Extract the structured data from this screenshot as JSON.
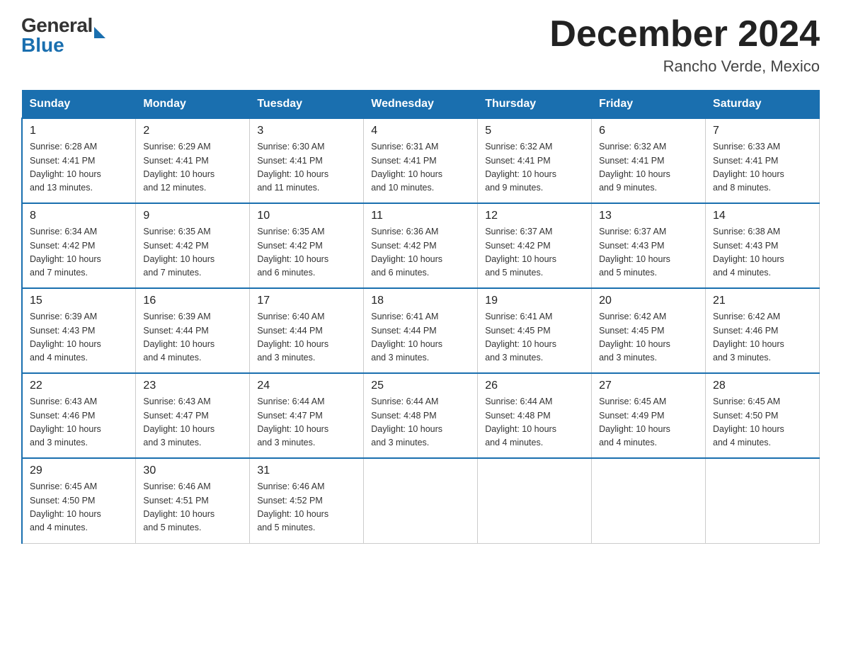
{
  "header": {
    "logo_general": "General",
    "logo_blue": "Blue",
    "title": "December 2024",
    "subtitle": "Rancho Verde, Mexico"
  },
  "days_of_week": [
    "Sunday",
    "Monday",
    "Tuesday",
    "Wednesday",
    "Thursday",
    "Friday",
    "Saturday"
  ],
  "weeks": [
    [
      {
        "day": "1",
        "sunrise": "6:28 AM",
        "sunset": "4:41 PM",
        "daylight": "10 hours and 13 minutes."
      },
      {
        "day": "2",
        "sunrise": "6:29 AM",
        "sunset": "4:41 PM",
        "daylight": "10 hours and 12 minutes."
      },
      {
        "day": "3",
        "sunrise": "6:30 AM",
        "sunset": "4:41 PM",
        "daylight": "10 hours and 11 minutes."
      },
      {
        "day": "4",
        "sunrise": "6:31 AM",
        "sunset": "4:41 PM",
        "daylight": "10 hours and 10 minutes."
      },
      {
        "day": "5",
        "sunrise": "6:32 AM",
        "sunset": "4:41 PM",
        "daylight": "10 hours and 9 minutes."
      },
      {
        "day": "6",
        "sunrise": "6:32 AM",
        "sunset": "4:41 PM",
        "daylight": "10 hours and 9 minutes."
      },
      {
        "day": "7",
        "sunrise": "6:33 AM",
        "sunset": "4:41 PM",
        "daylight": "10 hours and 8 minutes."
      }
    ],
    [
      {
        "day": "8",
        "sunrise": "6:34 AM",
        "sunset": "4:42 PM",
        "daylight": "10 hours and 7 minutes."
      },
      {
        "day": "9",
        "sunrise": "6:35 AM",
        "sunset": "4:42 PM",
        "daylight": "10 hours and 7 minutes."
      },
      {
        "day": "10",
        "sunrise": "6:35 AM",
        "sunset": "4:42 PM",
        "daylight": "10 hours and 6 minutes."
      },
      {
        "day": "11",
        "sunrise": "6:36 AM",
        "sunset": "4:42 PM",
        "daylight": "10 hours and 6 minutes."
      },
      {
        "day": "12",
        "sunrise": "6:37 AM",
        "sunset": "4:42 PM",
        "daylight": "10 hours and 5 minutes."
      },
      {
        "day": "13",
        "sunrise": "6:37 AM",
        "sunset": "4:43 PM",
        "daylight": "10 hours and 5 minutes."
      },
      {
        "day": "14",
        "sunrise": "6:38 AM",
        "sunset": "4:43 PM",
        "daylight": "10 hours and 4 minutes."
      }
    ],
    [
      {
        "day": "15",
        "sunrise": "6:39 AM",
        "sunset": "4:43 PM",
        "daylight": "10 hours and 4 minutes."
      },
      {
        "day": "16",
        "sunrise": "6:39 AM",
        "sunset": "4:44 PM",
        "daylight": "10 hours and 4 minutes."
      },
      {
        "day": "17",
        "sunrise": "6:40 AM",
        "sunset": "4:44 PM",
        "daylight": "10 hours and 3 minutes."
      },
      {
        "day": "18",
        "sunrise": "6:41 AM",
        "sunset": "4:44 PM",
        "daylight": "10 hours and 3 minutes."
      },
      {
        "day": "19",
        "sunrise": "6:41 AM",
        "sunset": "4:45 PM",
        "daylight": "10 hours and 3 minutes."
      },
      {
        "day": "20",
        "sunrise": "6:42 AM",
        "sunset": "4:45 PM",
        "daylight": "10 hours and 3 minutes."
      },
      {
        "day": "21",
        "sunrise": "6:42 AM",
        "sunset": "4:46 PM",
        "daylight": "10 hours and 3 minutes."
      }
    ],
    [
      {
        "day": "22",
        "sunrise": "6:43 AM",
        "sunset": "4:46 PM",
        "daylight": "10 hours and 3 minutes."
      },
      {
        "day": "23",
        "sunrise": "6:43 AM",
        "sunset": "4:47 PM",
        "daylight": "10 hours and 3 minutes."
      },
      {
        "day": "24",
        "sunrise": "6:44 AM",
        "sunset": "4:47 PM",
        "daylight": "10 hours and 3 minutes."
      },
      {
        "day": "25",
        "sunrise": "6:44 AM",
        "sunset": "4:48 PM",
        "daylight": "10 hours and 3 minutes."
      },
      {
        "day": "26",
        "sunrise": "6:44 AM",
        "sunset": "4:48 PM",
        "daylight": "10 hours and 4 minutes."
      },
      {
        "day": "27",
        "sunrise": "6:45 AM",
        "sunset": "4:49 PM",
        "daylight": "10 hours and 4 minutes."
      },
      {
        "day": "28",
        "sunrise": "6:45 AM",
        "sunset": "4:50 PM",
        "daylight": "10 hours and 4 minutes."
      }
    ],
    [
      {
        "day": "29",
        "sunrise": "6:45 AM",
        "sunset": "4:50 PM",
        "daylight": "10 hours and 4 minutes."
      },
      {
        "day": "30",
        "sunrise": "6:46 AM",
        "sunset": "4:51 PM",
        "daylight": "10 hours and 5 minutes."
      },
      {
        "day": "31",
        "sunrise": "6:46 AM",
        "sunset": "4:52 PM",
        "daylight": "10 hours and 5 minutes."
      },
      null,
      null,
      null,
      null
    ]
  ],
  "labels": {
    "sunrise": "Sunrise:",
    "sunset": "Sunset:",
    "daylight": "Daylight:"
  }
}
